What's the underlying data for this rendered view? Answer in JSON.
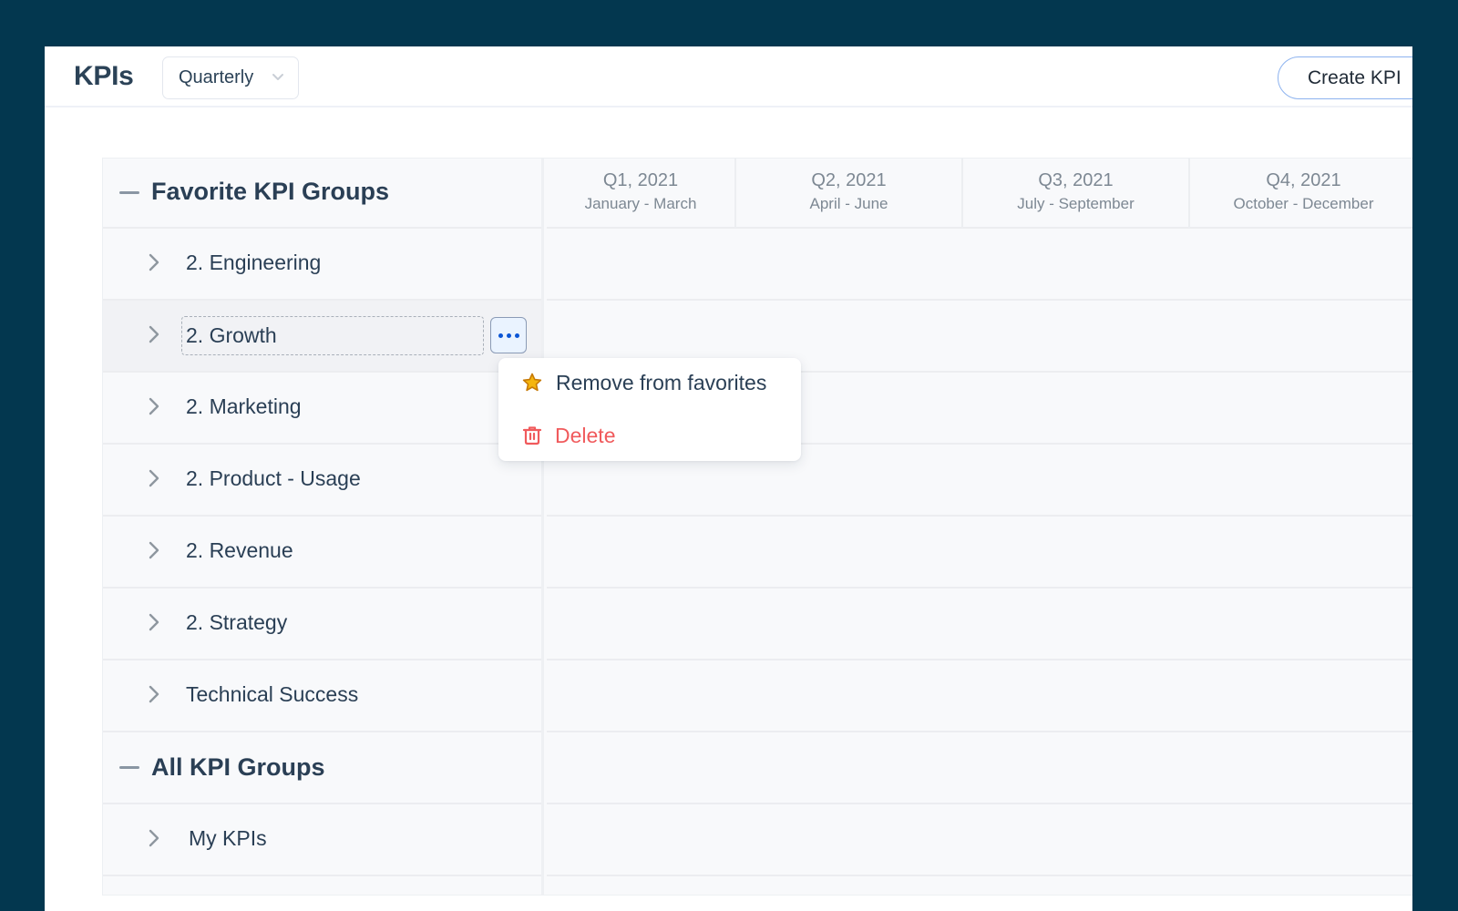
{
  "header": {
    "title": "KPIs",
    "period_select": {
      "value": "Quarterly"
    },
    "create_button": "Create KPI"
  },
  "columns": [
    {
      "quarter": "Q1, 2021",
      "range": "January - March"
    },
    {
      "quarter": "Q2, 2021",
      "range": "April - June"
    },
    {
      "quarter": "Q3, 2021",
      "range": "July - September"
    },
    {
      "quarter": "Q4, 2021",
      "range": "October - December"
    }
  ],
  "favorites": {
    "title": "Favorite KPI Groups",
    "items": [
      {
        "label": "2. Engineering"
      },
      {
        "label": "2. Growth"
      },
      {
        "label": "2. Marketing"
      },
      {
        "label": "2. Product - Usage"
      },
      {
        "label": "2. Revenue"
      },
      {
        "label": "2. Strategy"
      },
      {
        "label": "Technical Success"
      }
    ]
  },
  "all_groups": {
    "title": "All KPI Groups",
    "items": [
      {
        "label": "My KPIs"
      }
    ]
  },
  "context_menu": {
    "items": [
      {
        "label": "Remove from favorites",
        "icon": "star-icon"
      },
      {
        "label": "Delete",
        "icon": "trash-icon"
      }
    ]
  },
  "colors": {
    "background": "#03374f",
    "accent": "#0b55d6",
    "danger": "#f05a5c",
    "star": "#f5b50e"
  }
}
